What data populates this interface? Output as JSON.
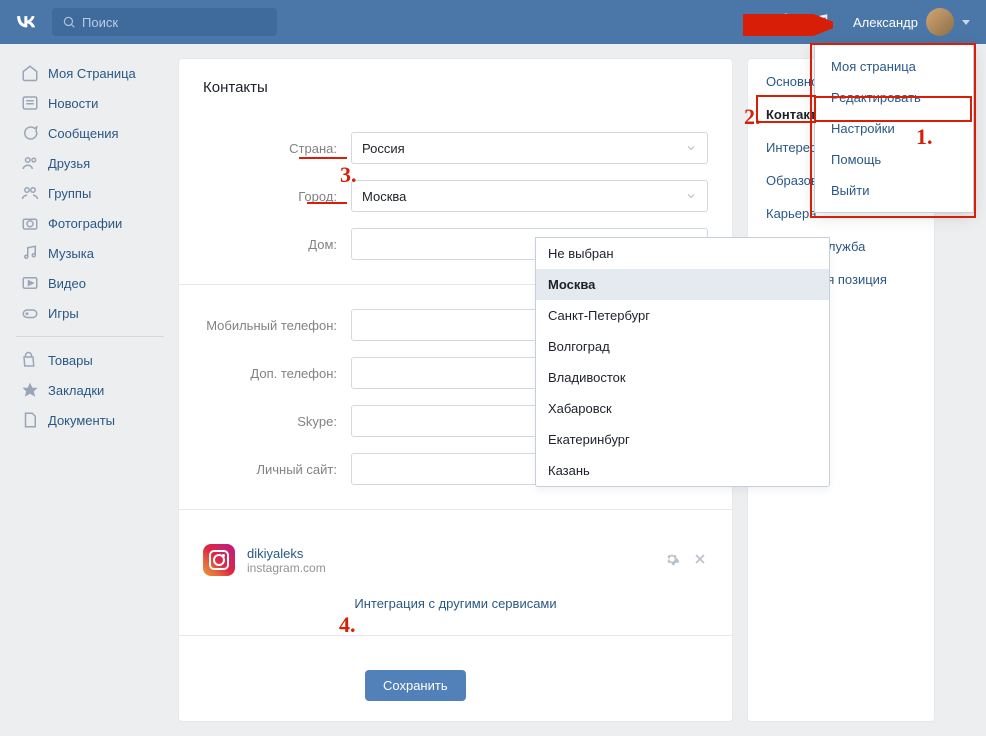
{
  "header": {
    "search_placeholder": "Поиск",
    "user_name": "Александр"
  },
  "sidebar": {
    "items": [
      {
        "label": "Моя Страница"
      },
      {
        "label": "Новости"
      },
      {
        "label": "Сообщения"
      },
      {
        "label": "Друзья"
      },
      {
        "label": "Группы"
      },
      {
        "label": "Фотографии"
      },
      {
        "label": "Музыка"
      },
      {
        "label": "Видео"
      },
      {
        "label": "Игры"
      }
    ],
    "items2": [
      {
        "label": "Товары"
      },
      {
        "label": "Закладки"
      },
      {
        "label": "Документы"
      }
    ]
  },
  "form": {
    "title": "Контакты",
    "labels": {
      "country": "Страна:",
      "city": "Город:",
      "home": "Дом:",
      "mobile": "Мобильный телефон:",
      "alt_phone": "Доп. телефон:",
      "skype": "Skype:",
      "site": "Личный сайт:"
    },
    "values": {
      "country": "Россия",
      "city": "Москва"
    },
    "integration": {
      "name": "dikiyaleks",
      "domain": "instagram.com",
      "link": "Интеграция с другими сервисами"
    },
    "save": "Сохранить"
  },
  "city_options": [
    "Не выбран",
    "Москва",
    "Санкт-Петербург",
    "Волгоград",
    "Владивосток",
    "Хабаровск",
    "Екатеринбург",
    "Казань"
  ],
  "tabs": [
    "Основное",
    "Контакты",
    "Интересы",
    "Образование",
    "Карьера",
    "Военная служба",
    "Жизненная позиция"
  ],
  "user_menu": [
    "Моя страница",
    "Редактировать",
    "Настройки",
    "Помощь",
    "Выйти"
  ],
  "callouts": {
    "c1": "1.",
    "c2": "2.",
    "c3": "3.",
    "c4": "4."
  }
}
